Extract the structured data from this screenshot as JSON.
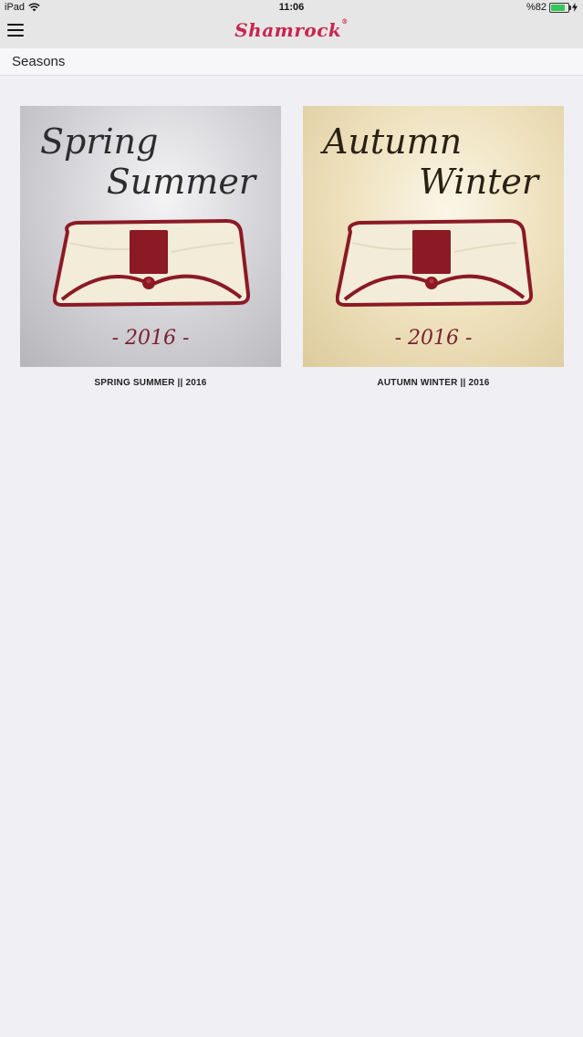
{
  "status": {
    "device": "iPad",
    "time": "11:06",
    "battery": "%82",
    "battery_level": 0.82
  },
  "nav": {
    "brand": "Shamrock",
    "brand_mark": "®"
  },
  "section": {
    "title": "Seasons"
  },
  "seasons": [
    {
      "line1": "Spring",
      "line2": "Summer",
      "year": "- 2016 -",
      "caption": "SPRING SUMMER || 2016"
    },
    {
      "line1": "Autumn",
      "line2": "Winter",
      "year": "- 2016 -",
      "caption": "AUTUMN WINTER || 2016"
    }
  ],
  "colors": {
    "brand": "#c8264e",
    "clutch_trim": "#8b1a25",
    "clutch_body": "#f2ecd9"
  },
  "icons": {
    "menu": "hamburger-menu-icon",
    "wifi": "wifi-icon",
    "battery": "battery-icon",
    "charging": "charging-bolt-icon"
  }
}
